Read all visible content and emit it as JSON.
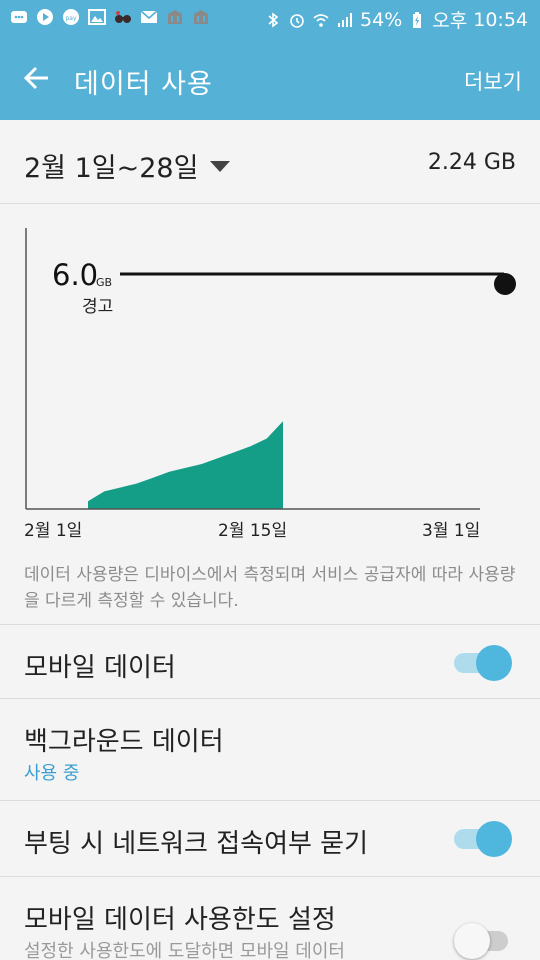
{
  "status_bar": {
    "battery": "54%",
    "ampm": "오후",
    "time": "10:54"
  },
  "app_bar": {
    "title": "데이터 사용",
    "more_label": "더보기"
  },
  "period": {
    "label": "2월 1일~28일",
    "total": "2.24 GB"
  },
  "warning": {
    "value": "6.0",
    "unit": "GB",
    "label": "경고"
  },
  "chart_data": {
    "type": "area",
    "x_labels": [
      "2월 1일",
      "2월 15일",
      "3월 1일"
    ],
    "warning_limit_gb": 6.0,
    "series": [
      {
        "values": [
          0.2,
          0.45,
          0.55,
          0.65,
          0.8,
          0.95,
          1.05,
          1.15,
          1.3,
          1.45,
          1.6,
          1.8,
          2.24
        ]
      }
    ],
    "colors": {
      "area": "#149d87",
      "warning_line": "#111111",
      "axis": "#555555"
    }
  },
  "note": "데이터 사용량은 디바이스에서 측정되며 서비스 공급자에 따라 사용량을 다르게 측정할 수 있습니다.",
  "settings": [
    {
      "title": "모바일 데이터",
      "subtitle": "",
      "on": true
    },
    {
      "title": "백그라운드 데이터",
      "subtitle": "사용 중"
    },
    {
      "title": "부팅 시 네트워크 접속여부 묻기",
      "subtitle": "",
      "on": true
    },
    {
      "title": "모바일 데이터 사용한도 설정",
      "subtitle": "설정한 사용한도에 도달하면 모바일 데이터",
      "on": false
    }
  ],
  "colors": {
    "accent": "#55b1d5",
    "subtitle_blue": "#3a9fd0",
    "subtitle_gray": "#9a9a9a"
  }
}
